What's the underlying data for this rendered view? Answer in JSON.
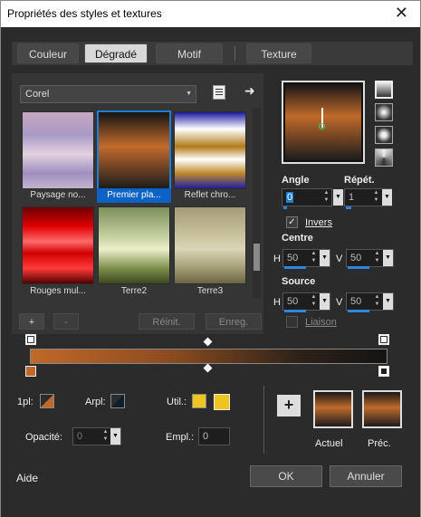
{
  "window": {
    "title": "Propriétés des styles et textures",
    "close_glyph": "✕"
  },
  "tabs": [
    {
      "label": "Couleur",
      "active": false
    },
    {
      "label": "Dégradé",
      "active": true
    },
    {
      "label": "Motif",
      "active": false
    },
    {
      "label": "Texture",
      "active": false
    }
  ],
  "library": {
    "selected": "Corel",
    "arrow": "▼"
  },
  "gradients": [
    {
      "label": "Paysage no...",
      "selected": false,
      "gradient": "linear-gradient(#c8a6bf,#a89ac6 30%,#e3d1df 55%,#9e8fbf 80%,#c4b3cf)"
    },
    {
      "label": "Premier pla...",
      "selected": true,
      "gradient": "linear-gradient(#141414 0%,#c26b2b 45%,#1c1c1c 100%)"
    },
    {
      "label": "Reflet chro...",
      "selected": false,
      "gradient": "linear-gradient(#1a1aa0 0%,#fff 22%,#b07a18 45%,#fff 62%,#c08a2a 80%,#2020a0 100%)"
    },
    {
      "label": "Rouges mul...",
      "selected": false,
      "gradient": "linear-gradient(#6b0000,#e00000 25%,#ff6a6a 45%,#d00000 60%,#ff3a3a 80%,#500000)"
    },
    {
      "label": "Terre2",
      "selected": false,
      "gradient": "linear-gradient(#7d8f5b,#c8d3a3 40%,#eef0cc 55%,#7e8e4a 80%,#3d4a22)"
    },
    {
      "label": "Terre3",
      "selected": false,
      "gradient": "linear-gradient(#a49b7a,#c8c09a 35%,#d9d5b5 55%,#a39b74 80%,#6b6445)"
    }
  ],
  "list_buttons": {
    "add": "+",
    "remove": "-",
    "reset": "Réinit.",
    "save": "Enreg."
  },
  "angle": {
    "label": "Angle",
    "value": "0"
  },
  "repeat": {
    "label": "Répét.",
    "value": "1"
  },
  "invert": {
    "label": "Invers",
    "checked": true
  },
  "centre": {
    "label": "Centre",
    "h_label": "H",
    "h_value": "50",
    "v_label": "V",
    "v_value": "50"
  },
  "source": {
    "label": "Source",
    "h_label": "H",
    "h_value": "50",
    "v_label": "V",
    "v_value": "50"
  },
  "link": {
    "label": "Liaison",
    "checked": false
  },
  "stops": {
    "fg_label": "1pl:",
    "bg_label": "Arpl:",
    "use_label": "Util.:",
    "opacity_label": "Opacité:",
    "opacity_value": "0",
    "location_label": "Empl.:",
    "location_value": "0",
    "fg_color": "#c0692a",
    "bg_color": "#0e1e2e",
    "use_color1": "#f0c420",
    "use_color2": "#f0c420"
  },
  "gradient_bar": {
    "start_color": "#c0692a",
    "end_color": "#141414"
  },
  "add_style": {
    "label": "+"
  },
  "current": {
    "label": "Actuel"
  },
  "previous": {
    "label": "Préc."
  },
  "footer": {
    "help": "Aide",
    "ok": "OK",
    "cancel": "Annuler"
  },
  "colors": {
    "accent": "#1f7fd1",
    "panel": "#2b2b2b",
    "orange": "#c0692a"
  }
}
